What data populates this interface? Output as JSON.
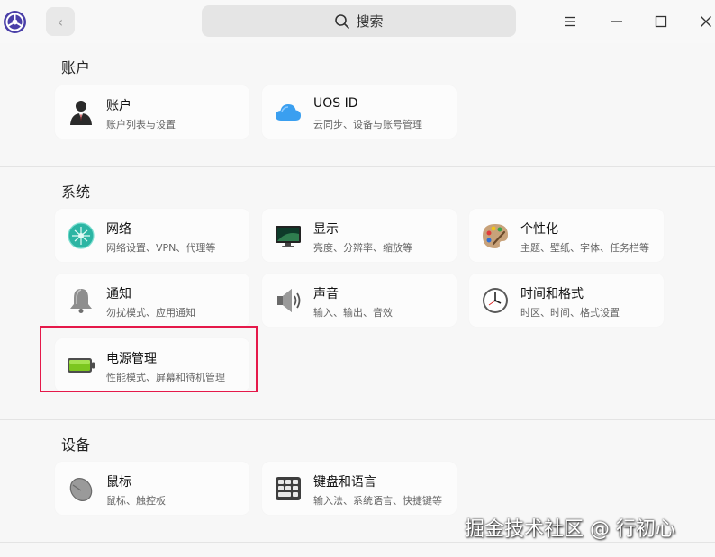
{
  "header": {
    "search_label": "搜索"
  },
  "sections": {
    "accounts": {
      "title": "账户",
      "items": [
        {
          "title": "账户",
          "desc": "账户列表与设置",
          "icon": "user-icon"
        },
        {
          "title": "UOS ID",
          "desc": "云同步、设备与账号管理",
          "icon": "cloud-icon"
        }
      ]
    },
    "system": {
      "title": "系统",
      "items": [
        {
          "title": "网络",
          "desc": "网络设置、VPN、代理等",
          "icon": "network-icon"
        },
        {
          "title": "显示",
          "desc": "亮度、分辨率、缩放等",
          "icon": "display-icon"
        },
        {
          "title": "个性化",
          "desc": "主题、壁纸、字体、任务栏等",
          "icon": "palette-icon"
        },
        {
          "title": "通知",
          "desc": "勿扰模式、应用通知",
          "icon": "bell-icon"
        },
        {
          "title": "声音",
          "desc": "输入、输出、音效",
          "icon": "speaker-icon"
        },
        {
          "title": "时间和格式",
          "desc": "时区、时间、格式设置",
          "icon": "clock-icon"
        },
        {
          "title": "电源管理",
          "desc": "性能模式、屏幕和待机管理",
          "icon": "battery-icon"
        }
      ]
    },
    "devices": {
      "title": "设备",
      "items": [
        {
          "title": "鼠标",
          "desc": "鼠标、触控板",
          "icon": "mouse-icon"
        },
        {
          "title": "键盘和语言",
          "desc": "输入法、系统语言、快捷键等",
          "icon": "keyboard-icon"
        }
      ]
    }
  },
  "watermark": "掘金技术社区 @ 行初心",
  "colors": {
    "highlight": "#e5194a",
    "battery": "#7cc61f"
  }
}
